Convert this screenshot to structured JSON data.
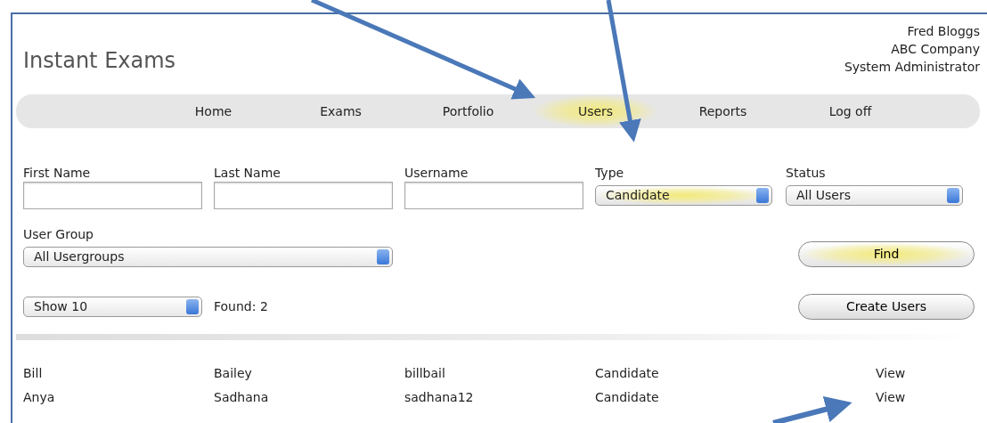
{
  "app_title": "Instant Exams",
  "user_info": [
    "Fred Bloggs",
    "ABC Company",
    "System Administrator"
  ],
  "nav": [
    {
      "label": "Home",
      "selected": false
    },
    {
      "label": "Exams",
      "selected": false
    },
    {
      "label": "Portfolio",
      "selected": false
    },
    {
      "label": "Users",
      "selected": true
    },
    {
      "label": "Reports",
      "selected": false
    },
    {
      "label": "Log off",
      "selected": false
    }
  ],
  "filters": [
    {
      "kind": "text",
      "label": "First Name"
    },
    {
      "kind": "text",
      "label": "Last Name"
    },
    {
      "kind": "text",
      "label": "Username"
    },
    {
      "kind": "select",
      "label": "Type",
      "value": "Candidate",
      "highlighted": true
    },
    {
      "kind": "select",
      "label": "Status",
      "value": "All Users",
      "highlighted": false
    }
  ],
  "user_group": {
    "label": "User Group",
    "value": "All Usergroups"
  },
  "find_button": {
    "label": "Find",
    "highlighted": true
  },
  "page_size": {
    "value": "Show 10"
  },
  "found": "Found: 2",
  "create_button": {
    "label": "Create Users",
    "highlighted": false
  },
  "rows": [
    [
      "Bill",
      "Bailey",
      "billbail",
      "Candidate",
      "View"
    ],
    [
      "Anya",
      "Sadhana",
      "sadhana12",
      "Candidate",
      "View"
    ]
  ]
}
